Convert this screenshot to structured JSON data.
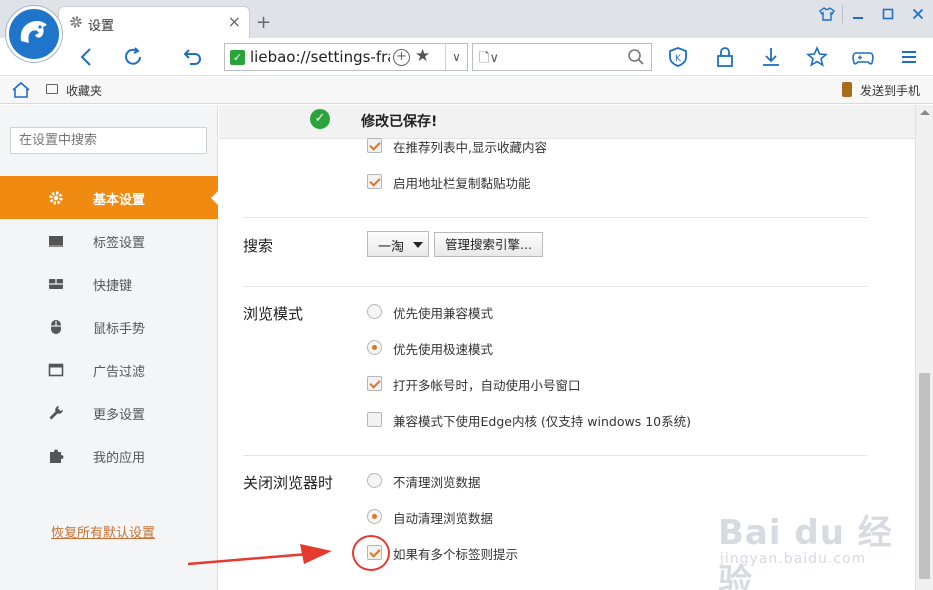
{
  "window": {
    "tab_title": "设置",
    "tab_close": "×",
    "new_tab": "+",
    "controls": {
      "skin": "👕",
      "minimize": "—",
      "maximize": "☐",
      "close": "✕"
    }
  },
  "navbar": {
    "address": "liebao://settings-frame/",
    "addr_plus": "+",
    "addr_star": "★",
    "addr_dropdown": "∨",
    "search_doc": "🗋∨"
  },
  "bookmarks": {
    "folder_label": "收藏夹",
    "send_to_phone": "发送到手机"
  },
  "sidebar": {
    "search_placeholder": "在设置中搜索",
    "items": [
      {
        "label": "基本设置",
        "icon": "gear-icon",
        "active": true
      },
      {
        "label": "标签设置",
        "icon": "tab-icon",
        "active": false
      },
      {
        "label": "快捷键",
        "icon": "keyboard-icon",
        "active": false
      },
      {
        "label": "鼠标手势",
        "icon": "mouse-icon",
        "active": false
      },
      {
        "label": "广告过滤",
        "icon": "window-icon",
        "active": false
      },
      {
        "label": "更多设置",
        "icon": "wrench-icon",
        "active": false
      },
      {
        "label": "我的应用",
        "icon": "puzzle-icon",
        "active": false
      }
    ],
    "reset_link": "恢复所有默认设置"
  },
  "content": {
    "toast_check": "✓",
    "toast": "修改已保存!",
    "general_options": [
      {
        "label": "在推荐列表中,显示收藏内容",
        "checked": true
      },
      {
        "label": "启用地址栏复制黏贴功能",
        "checked": true
      }
    ],
    "search": {
      "title": "搜索",
      "engine": "一淘",
      "manage_button": "管理搜索引擎..."
    },
    "browse_mode": {
      "title": "浏览模式",
      "options": [
        {
          "label": "优先使用兼容模式",
          "type": "radio",
          "checked": false
        },
        {
          "label": "优先使用极速模式",
          "type": "radio",
          "checked": true
        },
        {
          "label": "打开多帐号时，自动使用小号窗口",
          "type": "checkbox",
          "checked": true
        },
        {
          "label": "兼容模式下使用Edge内核 (仅支持 windows 10系统)",
          "type": "checkbox",
          "checked": false
        }
      ]
    },
    "on_close": {
      "title": "关闭浏览器时",
      "options": [
        {
          "label": "不清理浏览数据",
          "type": "radio",
          "checked": false
        },
        {
          "label": "自动清理浏览数据",
          "type": "radio",
          "checked": true
        },
        {
          "label": "如果有多个标签则提示",
          "type": "checkbox",
          "checked": true
        }
      ]
    }
  },
  "watermark": {
    "main": "Bai du 经验",
    "sub": "jingyan.baidu.com"
  },
  "colors": {
    "accent_orange": "#f08a10",
    "check_orange": "#e0741f",
    "browser_blue": "#1e6fc4",
    "success_green": "#2aa43a",
    "annotation_red": "#e53a30"
  }
}
